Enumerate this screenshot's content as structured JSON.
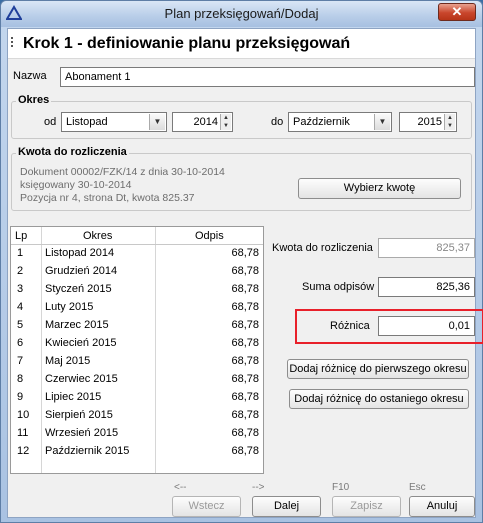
{
  "window": {
    "title": "Plan przeksięgowań/Dodaj",
    "close_label": "✕"
  },
  "header": {
    "step_title": "Krok 1 - definiowanie planu przeksięgowań"
  },
  "name": {
    "label": "Nazwa",
    "value": "Abonament 1"
  },
  "period": {
    "group_title": "Okres",
    "from_label": "od",
    "from_month": "Listopad",
    "from_year": "2014",
    "to_label": "do",
    "to_month": "Październik",
    "to_year": "2015"
  },
  "amount": {
    "group_title": "Kwota do rozliczenia",
    "line1": "Dokument 00002/FZK/14 z dnia 30-10-2014",
    "line2": "księgowany 30-10-2014",
    "line3": "Pozycja nr 4, strona Dt, kwota 825.37",
    "choose_button": "Wybierz kwotę"
  },
  "table": {
    "headers": {
      "lp": "Lp",
      "okres": "Okres",
      "odpis": "Odpis"
    },
    "rows": [
      {
        "lp": "1",
        "okres": "Listopad 2014",
        "odpis": "68,78"
      },
      {
        "lp": "2",
        "okres": "Grudzień 2014",
        "odpis": "68,78"
      },
      {
        "lp": "3",
        "okres": "Styczeń 2015",
        "odpis": "68,78"
      },
      {
        "lp": "4",
        "okres": "Luty 2015",
        "odpis": "68,78"
      },
      {
        "lp": "5",
        "okres": "Marzec 2015",
        "odpis": "68,78"
      },
      {
        "lp": "6",
        "okres": "Kwiecień 2015",
        "odpis": "68,78"
      },
      {
        "lp": "7",
        "okres": "Maj 2015",
        "odpis": "68,78"
      },
      {
        "lp": "8",
        "okres": "Czerwiec 2015",
        "odpis": "68,78"
      },
      {
        "lp": "9",
        "okres": "Lipiec 2015",
        "odpis": "68,78"
      },
      {
        "lp": "10",
        "okres": "Sierpień 2015",
        "odpis": "68,78"
      },
      {
        "lp": "11",
        "okres": "Wrzesień 2015",
        "odpis": "68,78"
      },
      {
        "lp": "12",
        "okres": "Październik 2015",
        "odpis": "68,78"
      }
    ]
  },
  "summary": {
    "to_settle_label": "Kwota do rozliczenia",
    "to_settle_value": "825,37",
    "sum_label": "Suma odpisów",
    "sum_value": "825,36",
    "diff_label": "Różnica",
    "diff_value": "0,01",
    "add_first_button": "Dodaj różnicę do pierwszego okresu",
    "add_last_button": "Dodaj różnicę do ostaniego okresu"
  },
  "footer": {
    "back_hint": "<--",
    "back_button": "Wstecz",
    "next_hint": "-->",
    "next_button": "Dalej",
    "save_hint": "F10",
    "save_button": "Zapisz",
    "cancel_hint": "Esc",
    "cancel_button": "Anuluj"
  },
  "colors": {
    "highlight": "#e8202a",
    "titlebar": "#b8cde8"
  },
  "icons": {
    "app": "delta-logo-icon",
    "close": "close-icon",
    "dropdown": "chevron-down-icon"
  }
}
